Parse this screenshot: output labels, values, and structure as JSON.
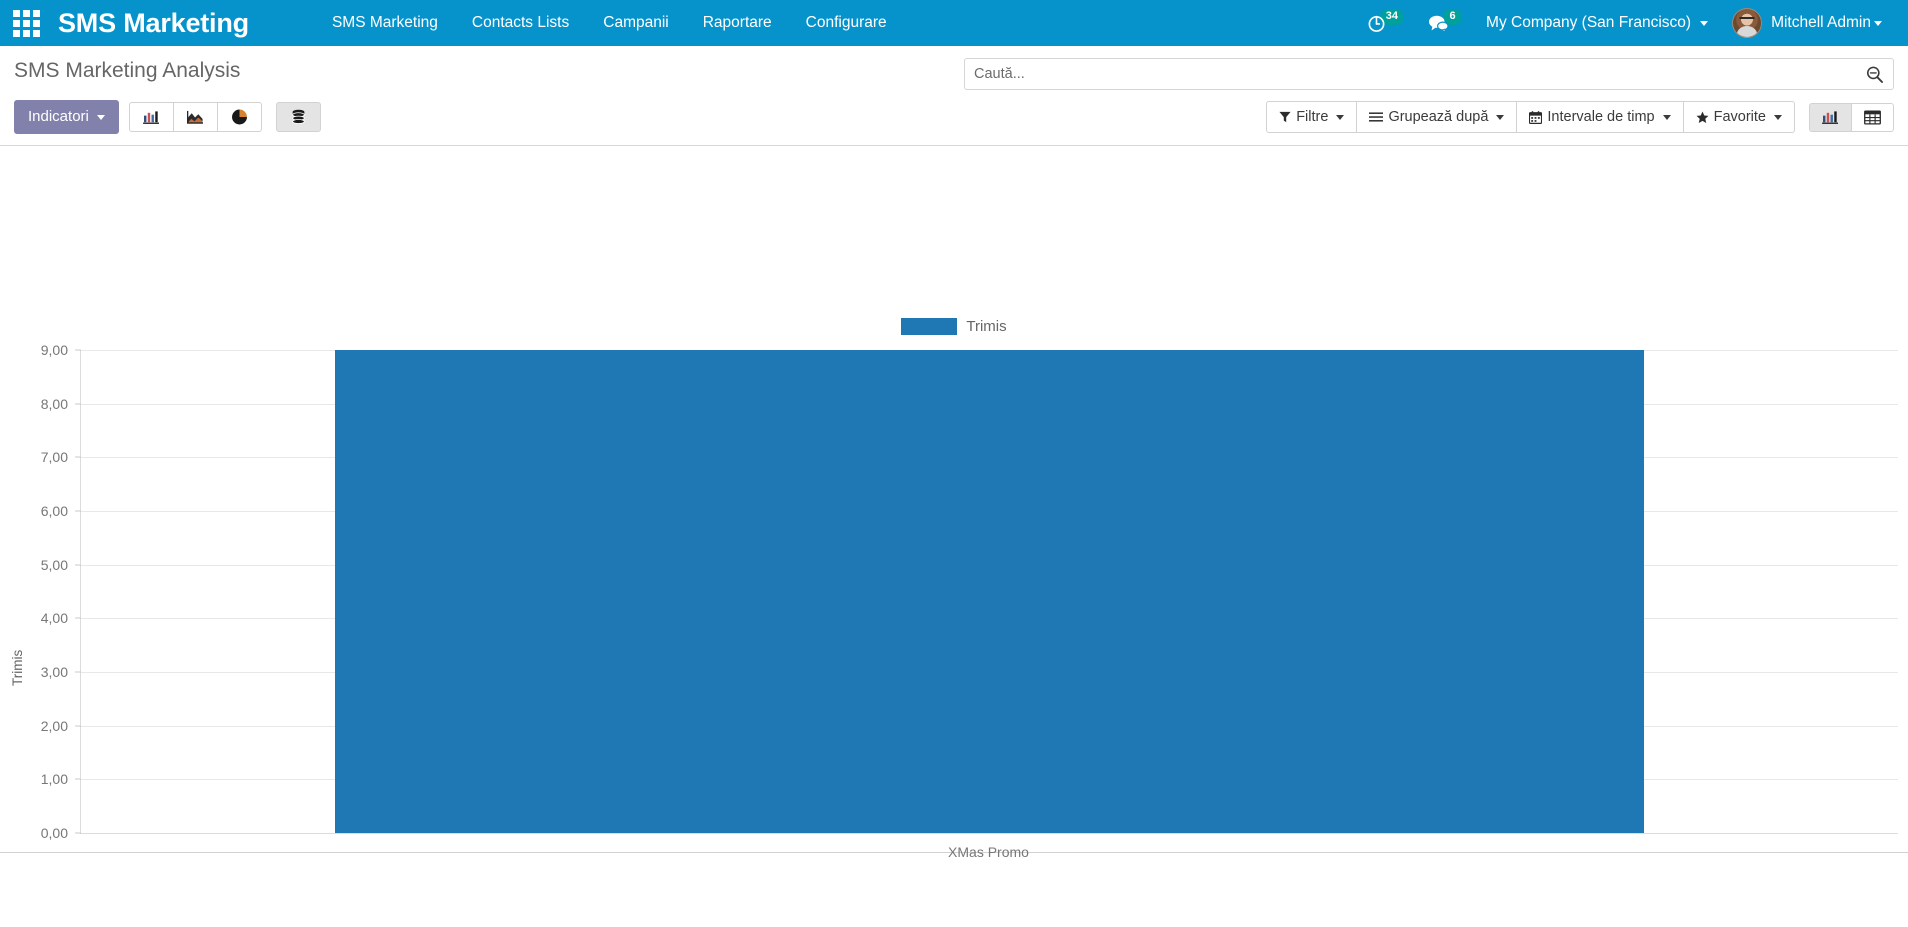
{
  "navbar": {
    "apps_icon": "apps-grid-icon",
    "brand": "SMS Marketing",
    "menu": [
      {
        "label": "SMS Marketing"
      },
      {
        "label": "Contacts Lists"
      },
      {
        "label": "Campanii"
      },
      {
        "label": "Raportare"
      },
      {
        "label": "Configurare"
      }
    ],
    "activities": {
      "icon": "clock-icon",
      "count": "34"
    },
    "messages": {
      "icon": "chat-bubble-icon",
      "count": "6"
    },
    "company": "My Company (San Francisco)",
    "user": "Mitchell Admin",
    "avatar_icon": "user-avatar",
    "brand_color": "#0693cc",
    "badge_color": "#00a09d"
  },
  "control_panel": {
    "title": "SMS Marketing Analysis",
    "search": {
      "placeholder": "Caută...",
      "value": "",
      "icon": "search-icon"
    },
    "measures_button": {
      "label": "Indicatori",
      "color": "#8181ab"
    },
    "chart_type_buttons": [
      {
        "name": "bar-chart",
        "icon": "bar-chart-icon",
        "active": false
      },
      {
        "name": "line-chart",
        "icon": "area-chart-icon",
        "active": false
      },
      {
        "name": "pie-chart",
        "icon": "pie-chart-icon",
        "active": false
      }
    ],
    "stacked_button": {
      "name": "stacked",
      "icon": "database-stack-icon",
      "active": true
    },
    "filters": [
      {
        "label": "Filtre",
        "icon": "funnel-icon"
      },
      {
        "label": "Grupează după",
        "icon": "list-bars-icon"
      },
      {
        "label": "Intervale de timp",
        "icon": "calendar-icon"
      },
      {
        "label": "Favorite",
        "icon": "star-icon"
      }
    ],
    "view_switcher": [
      {
        "name": "graph-view",
        "icon": "bar-chart-icon",
        "active": true
      },
      {
        "name": "pivot-view",
        "icon": "table-grid-icon",
        "active": false
      }
    ]
  },
  "chart_data": {
    "type": "bar",
    "title": "",
    "categories": [
      "XMas Promo"
    ],
    "series": [
      {
        "name": "Trimis",
        "values": [
          9
        ],
        "color": "#1f77b4"
      }
    ],
    "legend": [
      {
        "label": "Trimis",
        "color": "#1f77b4"
      }
    ],
    "legend_position": "top",
    "xlabel": "",
    "ylabel": "Trimis",
    "ylim": [
      0,
      9
    ],
    "ytick_labels": [
      "9,00",
      "8,00",
      "7,00",
      "6,00",
      "5,00",
      "4,00",
      "3,00",
      "2,00",
      "1,00",
      "0,00"
    ],
    "ytick_values": [
      9,
      8,
      7,
      6,
      5,
      4,
      3,
      2,
      1,
      0
    ],
    "grid": true
  }
}
